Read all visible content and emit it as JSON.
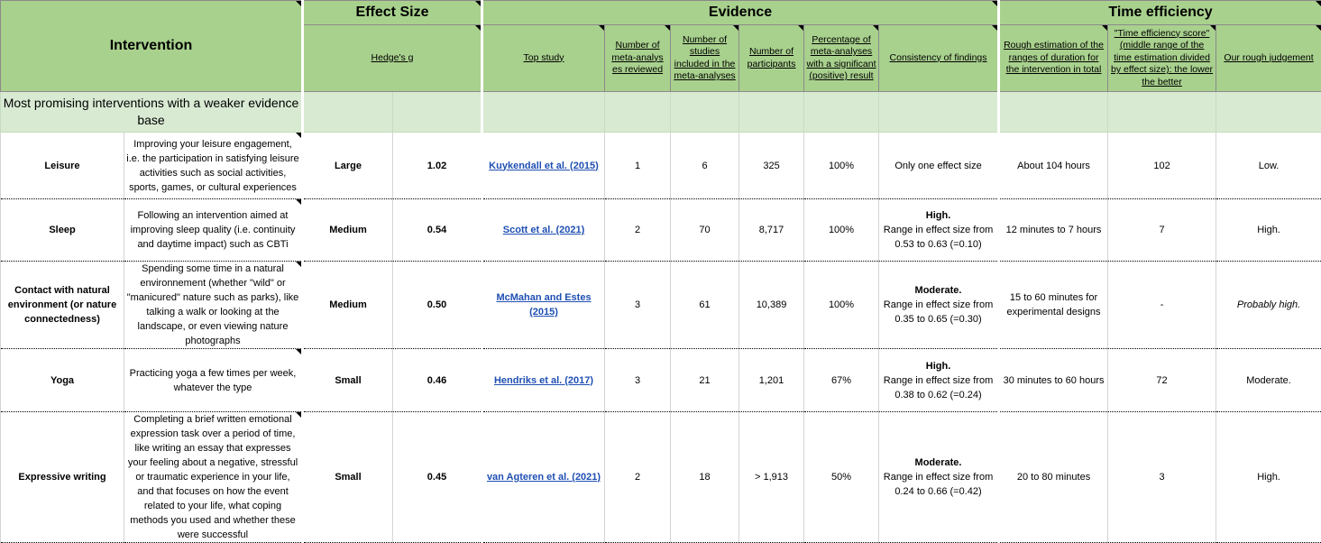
{
  "header": {
    "intervention": "Intervention",
    "groups": {
      "effect_size": "Effect Size",
      "evidence": "Evidence",
      "time_efficiency": "Time efficiency"
    },
    "columns": {
      "hedges_g": "Hedge's g",
      "top_study": "Top study",
      "num_meta": "Number of meta-analys es reviewed",
      "num_studies": "Number of studies included in the meta-analyses",
      "num_participants": "Number of participants",
      "pct_positive": "Percentage of meta-analyses with a significant (positive) result",
      "consistency": "Consistency of findings",
      "duration": "Rough estimation of the ranges of duration for the intervention in total",
      "time_score": "\"Time efficiency score\" (middle range of the time estimation divided by effect size): the lower the better",
      "judgement": "Our rough judgement"
    }
  },
  "section_label": "Most promising interventions with a weaker evidence base",
  "rows": [
    {
      "name": "Leisure",
      "description": "Improving your leisure engagement, i.e. the participation in satisfying leisure activities such as social activities, sports, games, or cultural experiences",
      "size": "Large",
      "g": "1.02",
      "study": "Kuykendall et al. (2015)",
      "meta": "1",
      "studies": "6",
      "participants": "325",
      "pct": "100%",
      "consistency_head": "",
      "consistency": "Only one effect size",
      "duration": "About 104 hours",
      "score": "102",
      "judgement": "Low."
    },
    {
      "name": "Sleep",
      "description": "Following an intervention aimed at improving sleep quality (i.e. continuity and daytime impact) such as CBTi",
      "size": "Medium",
      "g": "0.54",
      "study": "Scott et al. (2021)",
      "meta": "2",
      "studies": "70",
      "participants": "8,717",
      "pct": "100%",
      "consistency_head": "High.",
      "consistency": "Range in effect size from 0.53 to 0.63 (=0.10)",
      "duration": "12 minutes to 7 hours",
      "score": "7",
      "judgement": "High."
    },
    {
      "name": "Contact with natural environment (or nature connectedness)",
      "description": "Spending some time in a natural environnement (whether \"wild\" or \"manicured\" nature such as parks), like talking a walk or looking at the landscape, or even viewing nature photographs",
      "size": "Medium",
      "g": "0.50",
      "study": "McMahan and Estes (2015)",
      "meta": "3",
      "studies": "61",
      "participants": "10,389",
      "pct": "100%",
      "consistency_head": "Moderate.",
      "consistency": "Range in effect size from 0.35 to 0.65 (=0.30)",
      "duration": "15 to 60 minutes for experimental designs",
      "score": "-",
      "judgement": "Probably high."
    },
    {
      "name": "Yoga",
      "description": "Practicing yoga a few times per week, whatever the type",
      "size": "Small",
      "g": "0.46",
      "study": "Hendriks et al. (2017)",
      "meta": "3",
      "studies": "21",
      "participants": "1,201",
      "pct": "67%",
      "consistency_head": "High.",
      "consistency": "Range in effect size from 0.38 to 0.62 (=0.24)",
      "duration": "30 minutes to 60 hours",
      "score": "72",
      "judgement": "Moderate."
    },
    {
      "name": "Expressive writing",
      "description": "Completing a brief written emotional expression task over a period of time, like writing an essay that expresses your feeling about a negative, stressful or traumatic experience in your life, and that focuses on how the event related to your life, what coping methods you used and whether these were successful",
      "size": "Small",
      "g": "0.45",
      "study": "van Agteren et al. (2021)",
      "meta": "2",
      "studies": "18",
      "participants": "> 1,913",
      "pct": "50%",
      "consistency_head": "Moderate.",
      "consistency": "Range in effect size from 0.24 to 0.66 (=0.42)",
      "duration": "20 to 80 minutes",
      "score": "3",
      "judgement": "High."
    }
  ],
  "colors": {
    "header_green": "#a9d18e",
    "section_green": "#d9ead3",
    "link_blue": "#1f4fb3"
  }
}
